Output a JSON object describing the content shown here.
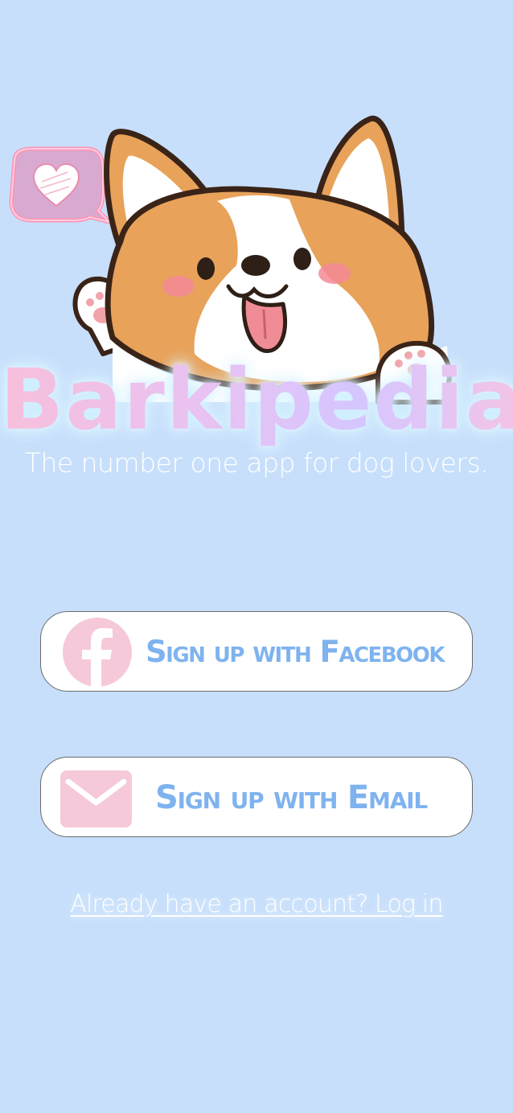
{
  "app": {
    "title": "Barkipedia",
    "tagline": "The number one app for dog lovers."
  },
  "buttons": {
    "facebook_label": "Sign up with Facebook",
    "email_label": "Sign up with Email"
  },
  "login": {
    "text": "Already have an account? Log in"
  },
  "icons": {
    "facebook": "facebook-icon",
    "email": "envelope-icon",
    "heart_bubble": "heart-speech-bubble-icon",
    "mascot": "corgi-mascot"
  },
  "colors": {
    "background": "#c7dffb",
    "button_text": "#7fb3ef",
    "icon_pink": "#f6c9da",
    "button_bg": "#ffffff"
  }
}
